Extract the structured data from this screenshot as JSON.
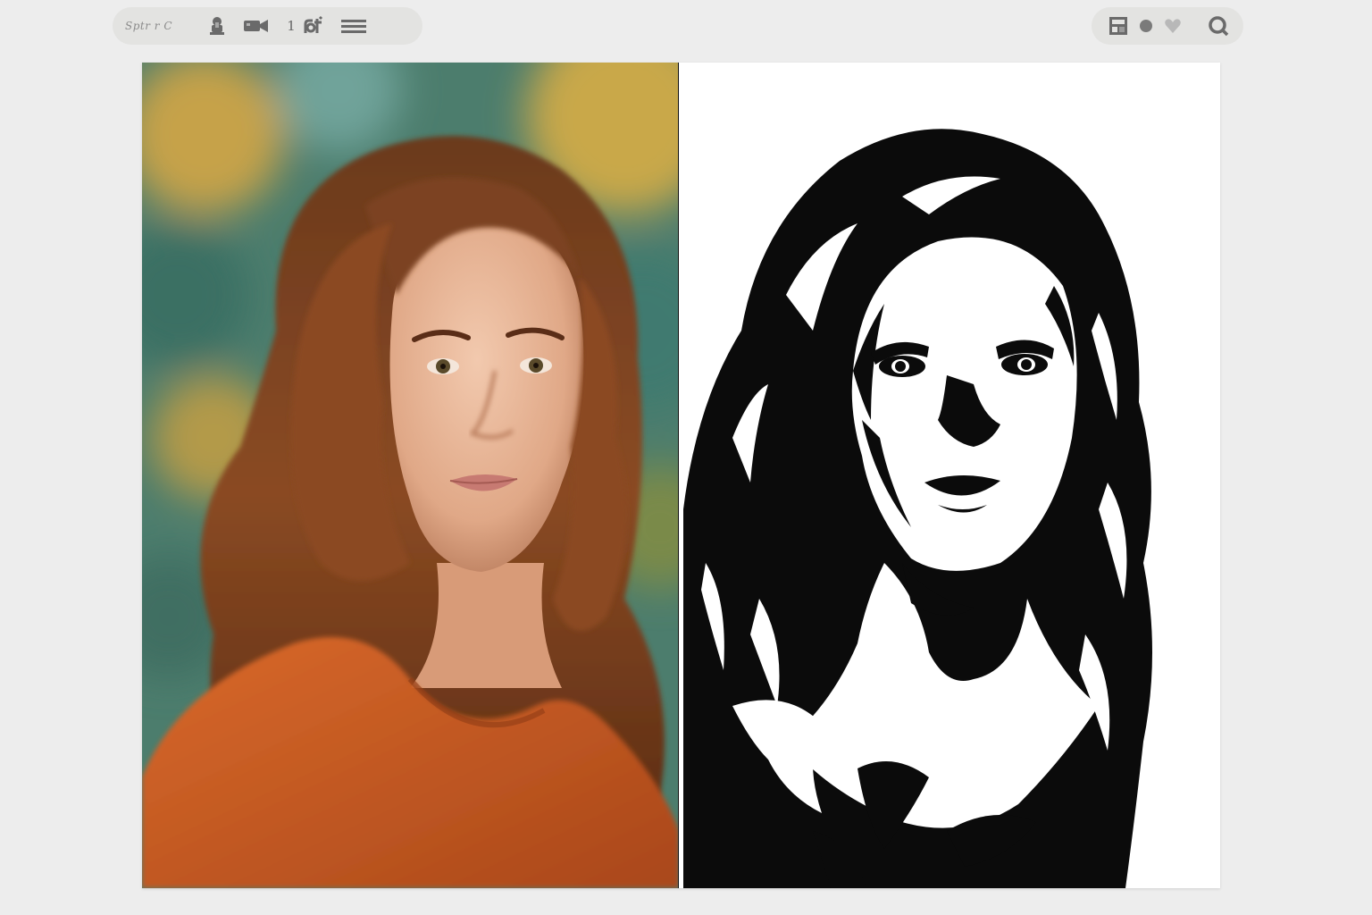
{
  "toolbar_left": {
    "brand": "Sptr r C",
    "page_number": "1",
    "icons": [
      "brush-icon",
      "stamp-icon",
      "video-camera-icon",
      "edit-tool-icon",
      "menu-icon"
    ]
  },
  "toolbar_right": {
    "icons": [
      "layout-panel-icon",
      "color-dot-icon",
      "heart-icon",
      "search-icon"
    ]
  },
  "canvas": {
    "left_panel": "portrait-photo",
    "right_panel": "black-and-white-stencil"
  },
  "colors": {
    "background": "#ededed",
    "toolbar": "#e3e3e1",
    "icon": "#6a6a6a",
    "hair": "#7a3f1c",
    "skin": "#e8b69a",
    "sweater": "#c45a1f",
    "backdrop_teal": "#3f7a6c",
    "backdrop_gold": "#b59a45",
    "stencil_ink": "#0b0b0b"
  }
}
